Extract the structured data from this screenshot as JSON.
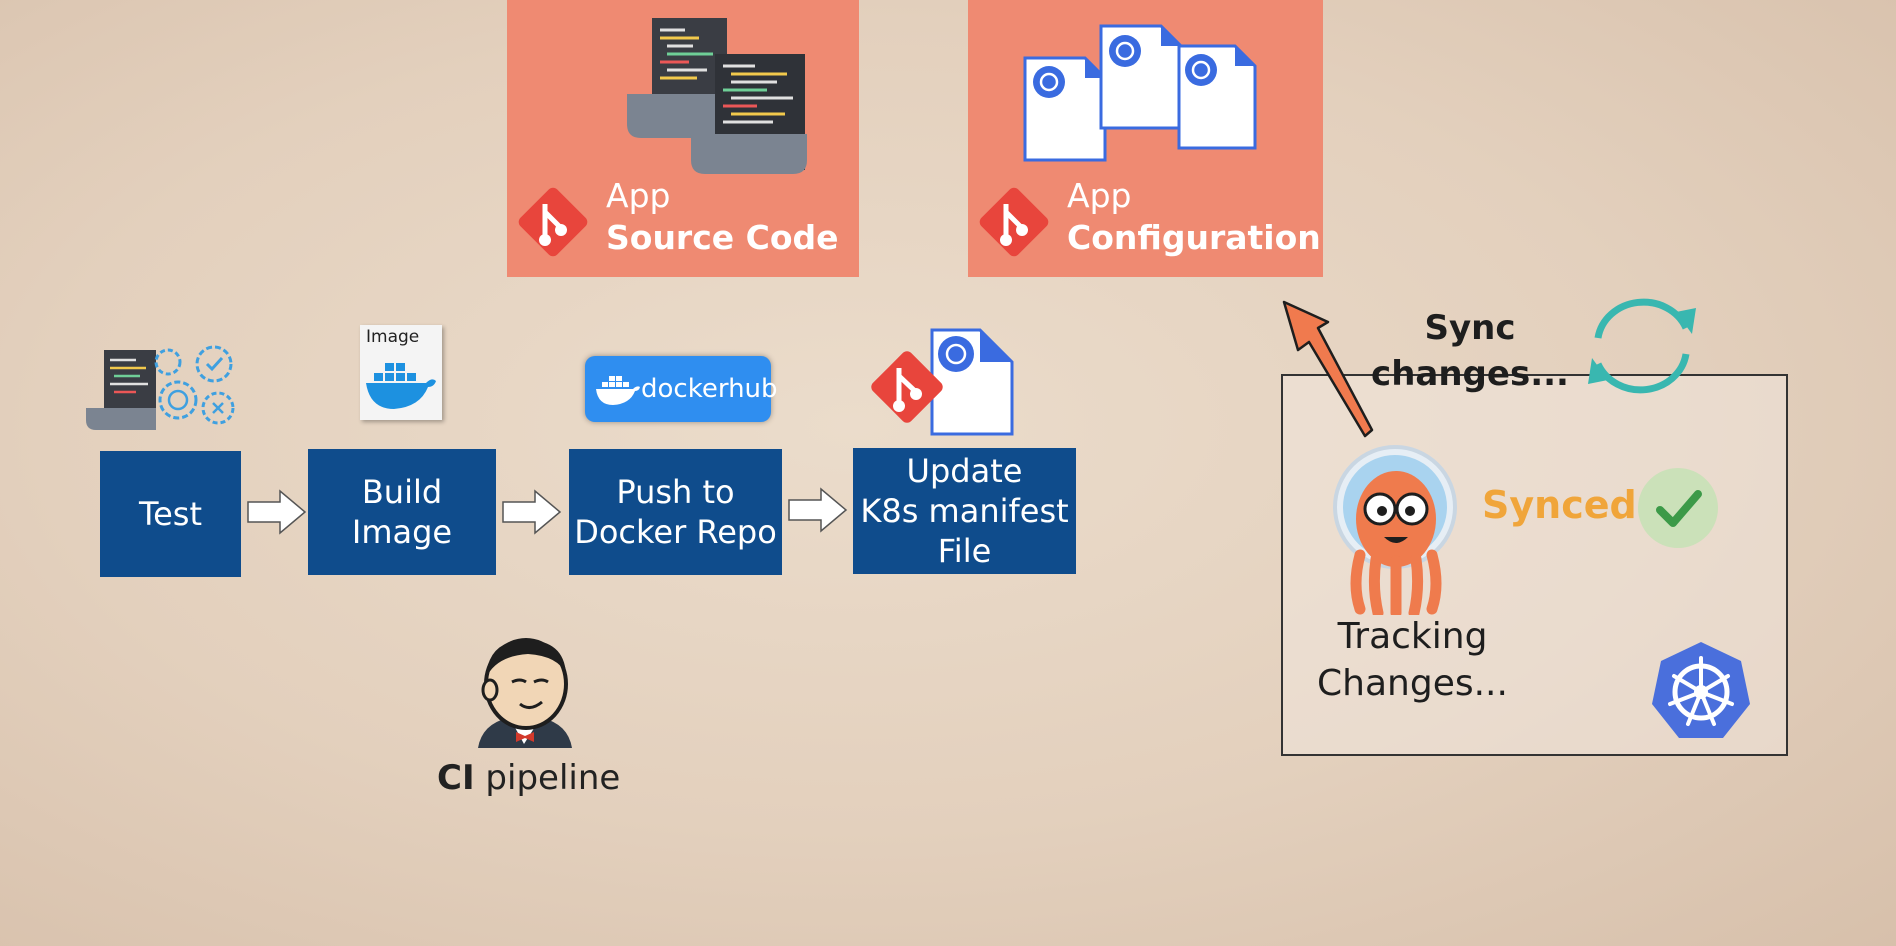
{
  "repos": {
    "source": {
      "line1": "App",
      "line2": "Source Code"
    },
    "config": {
      "line1": "App",
      "line2": "Configuration"
    }
  },
  "pipeline": {
    "steps": [
      {
        "label": "Test"
      },
      {
        "label": "Build\nImage"
      },
      {
        "label": "Push to\nDocker Repo"
      },
      {
        "label": "Update\nK8s manifest\nFile"
      }
    ],
    "image_card_label": "Image",
    "dockerhub_label": "dockerhub",
    "ci_label_bold": "CI",
    "ci_label_rest": " pipeline"
  },
  "argo": {
    "sync_label": "Sync\nchanges...",
    "tracking_label": "Tracking\nChanges...",
    "status_label": "Synced"
  },
  "colors": {
    "repo_bg": "#ef8a72",
    "step_bg": "#0f4c8c",
    "git_red": "#e8453c",
    "k8s_blue": "#3a6be0",
    "synced_orange": "#f0a53a",
    "sync_arrow": "#f07a4e",
    "sync_icon": "#39b7b0"
  },
  "icons": [
    "code-file-icon",
    "git-icon",
    "k8s-manifest-icon",
    "gears-icon",
    "docker-image-icon",
    "dockerhub-logo",
    "jenkins-logo",
    "argo-octopus-icon",
    "sync-cycle-icon",
    "check-icon",
    "kubernetes-icon",
    "arrow-right-icon",
    "arrow-up-icon"
  ]
}
